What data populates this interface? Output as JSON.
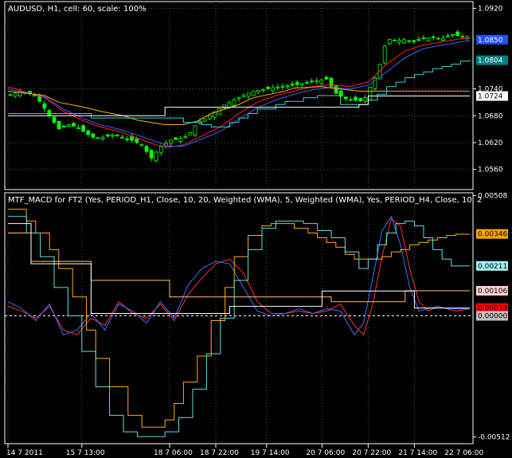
{
  "window": {
    "main_title": "AUDUSD, H1, cell: 60, scale: 100%",
    "sub_title": "MTF_MACD for FT2 (Yes, PERIOD_H1, Close, 10, 20, Weighted (WMA), 5, Weighted (WMA), Yes, PERIOD_H4, Close, 10, 2"
  },
  "colors": {
    "background": "#000000",
    "frame": "#ffffff",
    "grid": "#5a5a5a",
    "candle_bull": "#000000",
    "candle_bear": "#00ff00",
    "candle_wick": "#00ff00"
  },
  "chart_data": [
    {
      "type": "candlestick",
      "title": "AUDUSD, H1, cell: 60, scale: 100%",
      "ylim": [
        1.0515,
        1.0935
      ],
      "ytick_values": [
        1.092,
        1.074,
        1.068,
        1.062,
        1.056
      ],
      "ytick_labels": [
        "1.0920",
        "1.0740",
        "1.0680",
        "1.0620",
        "1.0560"
      ],
      "xlim": [
        0,
        100
      ],
      "series": [
        {
          "kind": "price",
          "color": "#00ff00",
          "x": [
            0,
            3,
            6,
            9,
            11,
            13,
            15,
            17,
            19,
            21,
            23,
            25,
            27,
            29,
            31,
            33,
            35,
            37,
            39,
            41,
            43,
            45,
            47,
            49,
            51,
            53,
            55,
            57,
            59,
            61,
            63,
            65,
            67,
            69,
            71,
            73,
            75,
            77,
            78,
            80,
            82,
            84,
            86,
            88,
            90,
            92,
            94,
            96,
            98,
            100
          ],
          "y": [
            1.0725,
            1.0735,
            1.0725,
            1.068,
            1.065,
            1.066,
            1.0655,
            1.064,
            1.0628,
            1.0633,
            1.0638,
            1.063,
            1.0625,
            1.0615,
            1.0585,
            1.061,
            1.0625,
            1.0628,
            1.0635,
            1.0665,
            1.0675,
            1.069,
            1.0705,
            1.0715,
            1.0725,
            1.0735,
            1.0738,
            1.0742,
            1.0745,
            1.0748,
            1.075,
            1.0755,
            1.0758,
            1.0762,
            1.073,
            1.0718,
            1.0715,
            1.0712,
            1.0735,
            1.0775,
            1.0852,
            1.0848,
            1.085,
            1.0845,
            1.0852,
            1.0855,
            1.0852,
            1.0862,
            1.0858,
            1.0856
          ]
        },
        {
          "kind": "line",
          "color": "#ff2020",
          "x": [
            0,
            8,
            12,
            16,
            20,
            24,
            28,
            32,
            35,
            38,
            42,
            46,
            50,
            54,
            58,
            62,
            66,
            70,
            74,
            78,
            82,
            86,
            90,
            94,
            98,
            100
          ],
          "y": [
            1.0745,
            1.072,
            1.069,
            1.067,
            1.0655,
            1.0645,
            1.063,
            1.0615,
            1.061,
            1.0615,
            1.0635,
            1.0655,
            1.0685,
            1.071,
            1.0725,
            1.0735,
            1.0745,
            1.075,
            1.0745,
            1.0755,
            1.0795,
            1.0825,
            1.0838,
            1.0845,
            1.0852,
            1.0852
          ]
        },
        {
          "kind": "line",
          "color": "#4060ff",
          "x": [
            0,
            8,
            12,
            16,
            20,
            24,
            28,
            32,
            35,
            38,
            42,
            46,
            50,
            54,
            58,
            62,
            66,
            70,
            74,
            78,
            82,
            86,
            90,
            94,
            98,
            100
          ],
          "y": [
            1.074,
            1.0722,
            1.0695,
            1.0675,
            1.066,
            1.065,
            1.0637,
            1.0622,
            1.0612,
            1.0612,
            1.0628,
            1.0645,
            1.0672,
            1.0698,
            1.0715,
            1.0728,
            1.0738,
            1.0744,
            1.074,
            1.0748,
            1.0778,
            1.081,
            1.083,
            1.0838,
            1.0845,
            1.0848
          ]
        },
        {
          "kind": "line",
          "color": "#ffaa20",
          "x": [
            0,
            8,
            11,
            16,
            20,
            25,
            28,
            34,
            38,
            41,
            44,
            50,
            53,
            60,
            62,
            68,
            70,
            76,
            100
          ],
          "y": [
            1.0735,
            1.0725,
            1.071,
            1.07,
            1.069,
            1.068,
            1.067,
            1.066,
            1.066,
            1.0668,
            1.0685,
            1.0705,
            1.072,
            1.0735,
            1.0742,
            1.0745,
            1.0742,
            1.0735,
            1.0735
          ]
        },
        {
          "kind": "step",
          "color": "#40d0d0",
          "x": [
            0,
            15,
            18,
            34,
            38,
            42,
            44,
            48,
            50,
            52,
            54,
            58,
            60,
            64,
            67,
            70,
            72,
            76,
            78,
            80,
            82,
            84,
            86,
            88,
            90,
            92,
            94,
            96,
            98,
            100
          ],
          "y": [
            1.0685,
            1.0685,
            1.0675,
            1.0675,
            1.0665,
            1.066,
            1.0655,
            1.0665,
            1.0675,
            1.0685,
            1.0695,
            1.0705,
            1.0712,
            1.072,
            1.0725,
            1.0725,
            1.0705,
            1.0705,
            1.0715,
            1.0728,
            1.0745,
            1.0755,
            1.0765,
            1.0772,
            1.0778,
            1.0785,
            1.079,
            1.0795,
            1.0802,
            1.0805
          ]
        },
        {
          "kind": "step",
          "color": "#ffffff",
          "x": [
            0,
            34,
            34,
            76,
            76,
            78,
            78,
            100
          ],
          "y": [
            1.068,
            1.068,
            1.0699,
            1.0699,
            1.0705,
            1.0705,
            1.0724,
            1.0724
          ]
        }
      ],
      "value_tags": [
        {
          "label": "1.0850",
          "value": 1.085,
          "bg": "#2050ff",
          "fg": "#ffffff"
        },
        {
          "label": "1.0804",
          "value": 1.0804,
          "bg": "#008080",
          "fg": "#ffffff"
        },
        {
          "label": "1.0724",
          "value": 1.0724,
          "bg": "#ffffff",
          "fg": "#000000"
        }
      ]
    },
    {
      "type": "line",
      "title": "MTF_MACD for FT2 (Yes, PERIOD_H1, Close, 10, 20, Weighted (WMA), 5, Weighted (WMA), Yes, PERIOD_H4, Close, 10, 2",
      "ylim": [
        -0.0054,
        0.0052
      ],
      "ytick_values": [
        0.00508,
        -0.00512
      ],
      "ytick_labels": [
        "0.00508",
        "-0.00512"
      ],
      "xlim": [
        0,
        100
      ],
      "zero_line": 0,
      "series": [
        {
          "kind": "line",
          "color": "#ff3030",
          "x": [
            0,
            3,
            6,
            9,
            12,
            15,
            18,
            21,
            24,
            27,
            30,
            33,
            36,
            39,
            42,
            45,
            48,
            51,
            54,
            57,
            60,
            63,
            66,
            69,
            72,
            75,
            77,
            79,
            81,
            83,
            85,
            87,
            89,
            91,
            93,
            95,
            97,
            100
          ],
          "y": [
            0.0004,
            0.0002,
            -0.0001,
            0.0004,
            -0.0006,
            -0.0008,
            -0.0001,
            -0.0004,
            0.0006,
            0.0001,
            -0.0001,
            0.0005,
            -0.0002,
            0.0009,
            0.0016,
            0.0022,
            0.0024,
            0.0018,
            0.0006,
            0.0001,
            0.0001,
            0.0002,
            0.0001,
            0.0002,
            0.0005,
            -0.0004,
            -0.0008,
            0.0005,
            0.0025,
            0.0041,
            0.0038,
            0.002,
            0.0006,
            0.0002,
            0.0004,
            0.0003,
            0.0002,
            0.0003
          ]
        },
        {
          "kind": "line",
          "color": "#4070ff",
          "x": [
            0,
            3,
            6,
            9,
            12,
            15,
            18,
            21,
            24,
            27,
            30,
            33,
            36,
            39,
            42,
            45,
            48,
            51,
            54,
            57,
            60,
            63,
            66,
            69,
            72,
            75,
            77,
            79,
            81,
            83,
            85,
            87,
            89,
            91,
            93,
            95,
            97,
            100
          ],
          "y": [
            0.0006,
            0.0003,
            -0.0002,
            0.0005,
            -0.0008,
            -0.0006,
            0.0001,
            -0.0006,
            0.0005,
            0.0002,
            -0.0003,
            0.0006,
            -0.0001,
            0.0013,
            0.002,
            0.0023,
            0.0022,
            0.0012,
            0.0002,
            0.0,
            0.0001,
            0.0003,
            0.0001,
            0.0003,
            0.0002,
            -0.0008,
            -0.0003,
            0.0016,
            0.0036,
            0.0042,
            0.003,
            0.0012,
            0.0002,
            0.0003,
            0.0004,
            0.0003,
            0.0003,
            0.0003
          ]
        },
        {
          "kind": "step",
          "color": "#ffaa20",
          "x": [
            0,
            4,
            6,
            9,
            11,
            14,
            17,
            19,
            22,
            26,
            29,
            31,
            34,
            36,
            38,
            41,
            44,
            47,
            49,
            52,
            55,
            57,
            59,
            62,
            65,
            67,
            69,
            71,
            73,
            75,
            77,
            79,
            81,
            83,
            85,
            87,
            89,
            91,
            93,
            95,
            97,
            100
          ],
          "y": [
            0.0045,
            0.004,
            0.0035,
            0.0028,
            0.002,
            0.0008,
            -0.0006,
            -0.0018,
            -0.003,
            -0.0042,
            -0.0047,
            -0.0047,
            -0.0044,
            -0.0037,
            -0.0028,
            -0.0017,
            -0.0002,
            0.0012,
            0.0025,
            0.0034,
            0.0038,
            0.0039,
            0.0039,
            0.0037,
            0.0035,
            0.0033,
            0.0031,
            0.0029,
            0.0026,
            0.0024,
            0.0024,
            0.0024,
            0.0025,
            0.0027,
            0.0028,
            0.003,
            0.0031,
            0.0032,
            0.0033,
            0.0034,
            0.00345,
            0.00346
          ]
        },
        {
          "kind": "step",
          "color": "#60e0e0",
          "x": [
            0,
            4,
            7,
            10,
            13,
            16,
            19,
            22,
            25,
            28,
            31,
            34,
            37,
            40,
            43,
            46,
            49,
            52,
            55,
            58,
            61,
            64,
            67,
            70,
            73,
            76,
            78,
            80,
            82,
            84,
            86,
            88,
            90,
            92,
            94,
            96,
            100
          ],
          "y": [
            0.0042,
            0.0035,
            0.0025,
            0.0012,
            0.0,
            -0.0015,
            -0.003,
            -0.0042,
            -0.0049,
            -0.0051,
            -0.0051,
            -0.0049,
            -0.0043,
            -0.0031,
            -0.0016,
            -0.0001,
            0.0015,
            0.0028,
            0.0037,
            0.004,
            0.004,
            0.0039,
            0.0036,
            0.0033,
            0.0027,
            0.002,
            0.0024,
            0.003,
            0.0035,
            0.0039,
            0.004,
            0.0038,
            0.0033,
            0.0028,
            0.0024,
            0.00211,
            0.00211
          ]
        },
        {
          "kind": "step",
          "color": "#ffc070",
          "x": [
            0,
            5,
            5,
            18,
            18,
            35,
            35,
            48,
            48,
            62,
            62,
            70,
            70,
            80,
            80,
            86,
            86,
            100
          ],
          "y": [
            0.0035,
            0.0035,
            0.0023,
            0.0023,
            0.0015,
            0.0015,
            0.0008,
            0.0008,
            0.0008,
            0.0008,
            0.0008,
            0.0008,
            0.0006,
            0.0006,
            0.0006,
            0.0006,
            0.00106,
            0.00106
          ]
        },
        {
          "kind": "step",
          "color": "#ffffff",
          "x": [
            0,
            5,
            5,
            18,
            18,
            48,
            48,
            68,
            68,
            88,
            88,
            100
          ],
          "y": [
            0.0039,
            0.0039,
            0.0022,
            0.0022,
            0.0001,
            0.0001,
            0.0004,
            0.0004,
            0.00105,
            0.00105,
            0.00033,
            0.00033
          ]
        }
      ],
      "value_tags": [
        {
          "label": "0.00346",
          "value": 0.00346,
          "bg": "#ffa500",
          "fg": "#000000"
        },
        {
          "label": "0.00211",
          "value": 0.00211,
          "bg": "#a0f0f0",
          "fg": "#000000"
        },
        {
          "label": "0.00106",
          "value": 0.00106,
          "bg": "#ffd0d0",
          "fg": "#000000"
        },
        {
          "label": "0.00033",
          "value": 0.00033,
          "bg": "#ff0000",
          "fg": "#000000"
        },
        {
          "label": "0.00000",
          "value": 0.0,
          "bg": "#c0c0c0",
          "fg": "#000000"
        }
      ]
    }
  ],
  "x_axis": {
    "tick_positions": [
      0,
      16,
      35,
      45,
      56,
      68,
      78,
      88
    ],
    "tick_labels": [
      "14 7 2011",
      "15 7 13:00",
      "18 7 06:00",
      "18 7 22:00",
      "19 7 14:00",
      "20 7 06:00",
      "20 7 22:00",
      "21 7 14:00",
      "22 7 06:00"
    ],
    "label_positions": [
      0,
      16,
      35,
      45,
      56,
      68,
      78,
      88,
      98
    ]
  }
}
